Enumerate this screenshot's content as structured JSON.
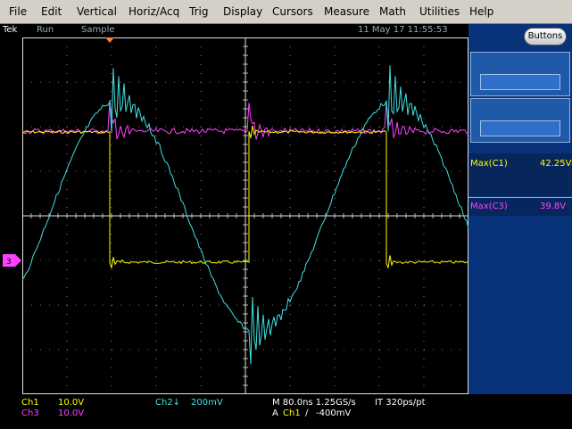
{
  "menu": [
    "File",
    "Edit",
    "Vertical",
    "Horiz/Acq",
    "Trig",
    "Display",
    "Cursors",
    "Measure",
    "Math",
    "Utilities",
    "Help"
  ],
  "status": {
    "brand": "Tek",
    "run": "Run",
    "mode": "Sample",
    "datetime": "11 May 17 11:55:53"
  },
  "side": {
    "buttons_label": "Buttons"
  },
  "measurements": [
    {
      "label": "Max(C1)",
      "value": "42.25V",
      "color": "#ffff00"
    },
    {
      "label": "Max(C3)",
      "value": "39.8V",
      "color": "#ff40ff"
    }
  ],
  "channels": {
    "ch1": {
      "label": "Ch1",
      "scale": "10.0V",
      "color": "#ffff00"
    },
    "ch3": {
      "label": "Ch3",
      "scale": "10.0V",
      "color": "#ff40ff"
    },
    "ch2": {
      "label": "Ch2↓",
      "scale": "200mV",
      "color": "#40e0e0"
    }
  },
  "horizontal": {
    "line1": "M 80.0ns 1.25GS/s",
    "record": "IT 320ps/pt",
    "trig_prefix": "A",
    "trig_channel": "Ch1",
    "trig_slope": "∕",
    "trig_level": "-400mV"
  },
  "marker3": "3",
  "colors": {
    "ch1": "#ffff00",
    "ch2": "#40e0e0",
    "ch3": "#ff40ff",
    "menu_bg": "#d4d0c8",
    "panel": "#08327a",
    "grid": "#ffffff"
  }
}
